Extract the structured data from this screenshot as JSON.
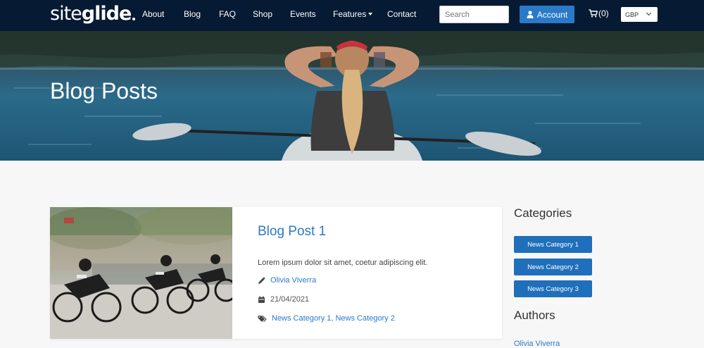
{
  "brand": {
    "logo_part1": "site",
    "logo_part2": "glide"
  },
  "nav": {
    "links": [
      "About",
      "Blog",
      "FAQ",
      "Shop",
      "Events",
      "Features",
      "Contact"
    ],
    "search_placeholder": "Search",
    "account_label": "Account",
    "cart_count": "(0)",
    "currency": "GBP"
  },
  "hero": {
    "title": "Blog Posts"
  },
  "post": {
    "title": "Blog Post 1",
    "excerpt": "Lorem ipsum dolor sit amet, coetur adipiscing elit.",
    "author": "Olivia Viverra",
    "date": "21/04/2021",
    "categories": "News Category 1, News Category 2"
  },
  "sidebar": {
    "categories_heading": "Categories",
    "categories": [
      "News Category 1",
      "News Category 2",
      "News Category 3"
    ],
    "authors_heading": "Authors",
    "authors": [
      "Olivia Viverra"
    ]
  },
  "colors": {
    "nav_bg": "#061a33",
    "accent": "#2a7ac7",
    "category_btn": "#1f6fba"
  }
}
